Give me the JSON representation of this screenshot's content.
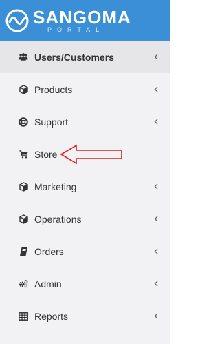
{
  "header": {
    "brand": "SANGOMA",
    "sub": "PORTAL",
    "background_color": "#3b8fd6"
  },
  "menu": [
    {
      "label": "Users/Customers",
      "icon": "users-icon",
      "has_submenu": true,
      "active": true
    },
    {
      "label": "Products",
      "icon": "cube-icon",
      "has_submenu": true
    },
    {
      "label": "Support",
      "icon": "life-ring-icon",
      "has_submenu": true
    },
    {
      "label": "Store",
      "icon": "cart-icon",
      "has_submenu": false
    },
    {
      "label": "Marketing",
      "icon": "cube-icon",
      "has_submenu": true
    },
    {
      "label": "Operations",
      "icon": "cube-icon",
      "has_submenu": true
    },
    {
      "label": "Orders",
      "icon": "book-icon",
      "has_submenu": true
    },
    {
      "label": "Admin",
      "icon": "cogs-icon",
      "has_submenu": true
    },
    {
      "label": "Reports",
      "icon": "table-icon",
      "has_submenu": true
    }
  ],
  "annotation": {
    "target": "Store",
    "color": "#e0201f"
  }
}
